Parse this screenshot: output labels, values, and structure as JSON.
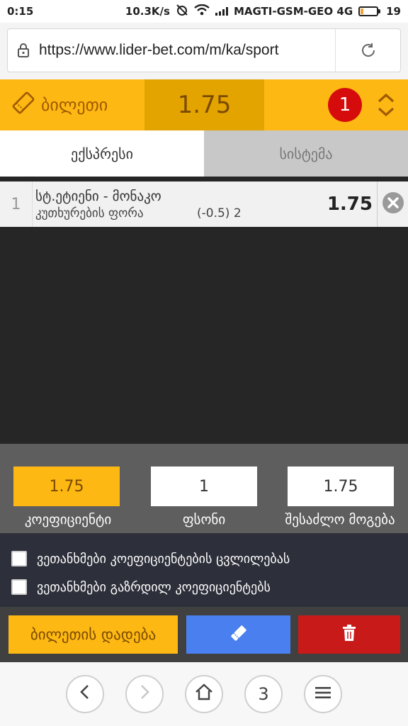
{
  "status_bar": {
    "time": "0:15",
    "speed": "10.3K/s",
    "carrier": "MAGTI-GSM-GEO 4G",
    "battery": "19",
    "battery_level": 0.19
  },
  "browser": {
    "url": "https://www.lider-bet.com/m/ka/sport",
    "tab_count": "3"
  },
  "ticket": {
    "label": "ბილეთი",
    "total_odds": "1.75",
    "count": "1"
  },
  "tabs": [
    {
      "label": "ექსპრესი",
      "active": true
    },
    {
      "label": "სისტემა",
      "active": false
    }
  ],
  "bets": [
    {
      "index": "1",
      "match": "სტ.ეტიენი - მონაკო",
      "market": "კუთხურების ფორა",
      "selection": "(-0.5) 2",
      "odds": "1.75"
    }
  ],
  "stake": {
    "coefficient": "1.75",
    "coefficient_label": "კოეფიციენტი",
    "amount": "1",
    "amount_label": "ფსონი",
    "possible_win": "1.75",
    "possible_win_label": "შესაძლო მოგება"
  },
  "agreements": [
    {
      "label": "ვეთანხმები კოეფიციენტების ცვლილებას",
      "checked": false
    },
    {
      "label": "ვეთანხმები გაზრდილ კოეფიციენტებს",
      "checked": false
    }
  ],
  "actions": {
    "place_label": "ბილეთის დადება"
  },
  "colors": {
    "brand_yellow": "#fdb813",
    "odds_dark_yellow": "#e3a400",
    "badge_red": "#d60c0c",
    "action_blue": "#4a7ff0",
    "delete_red": "#c91a1a"
  },
  "icons": [
    "alarm-off-icon",
    "wifi-icon",
    "signal-icon",
    "battery-icon",
    "lock-icon",
    "reload-icon",
    "ticket-icon",
    "expand-collapse-icon",
    "remove-icon",
    "trash-icon",
    "back-icon",
    "forward-icon",
    "home-icon",
    "menu-icon"
  ]
}
